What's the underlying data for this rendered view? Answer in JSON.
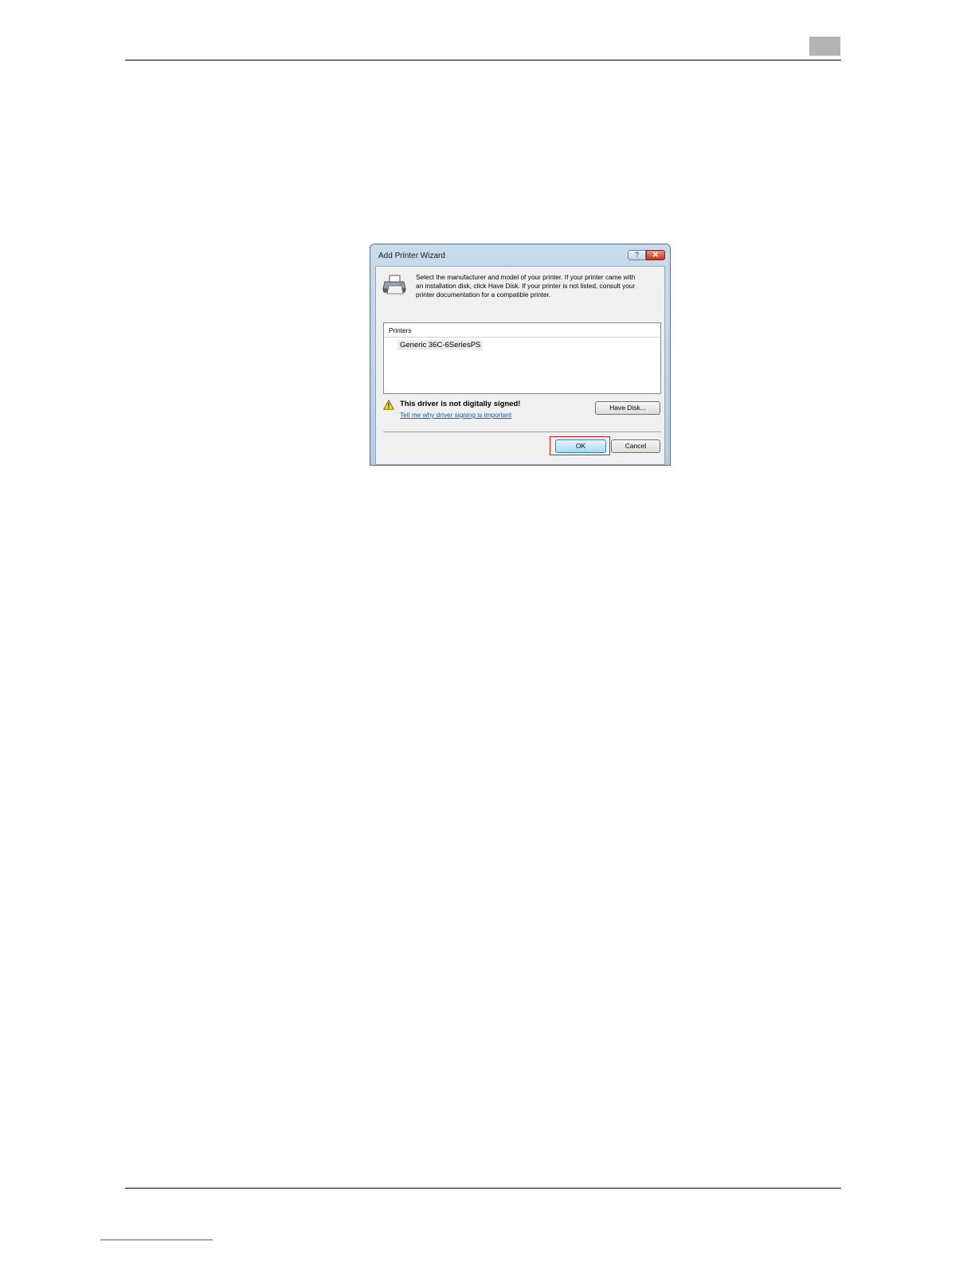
{
  "dialog": {
    "title": "Add Printer Wizard",
    "help_button": "?",
    "close_button": "✕",
    "description_lines": [
      "Select the manufacturer and model of your printer. If your printer came with",
      "an installation disk, click Have Disk. If your printer is not listed, consult your",
      "printer documentation for a compatible printer."
    ],
    "list_header": "Printers",
    "list_items": [
      "Generic 36C-6SeriesPS"
    ],
    "warning_title": "This driver is not digitally signed!",
    "warning_link": "Tell me why driver signing is important",
    "have_disk_button": "Have Disk...",
    "ok_button": "OK",
    "cancel_button": "Cancel"
  },
  "colors": {
    "highlight": "#e21a1a",
    "link": "#0a5fc7",
    "page_tab": "#b3b3b3"
  }
}
